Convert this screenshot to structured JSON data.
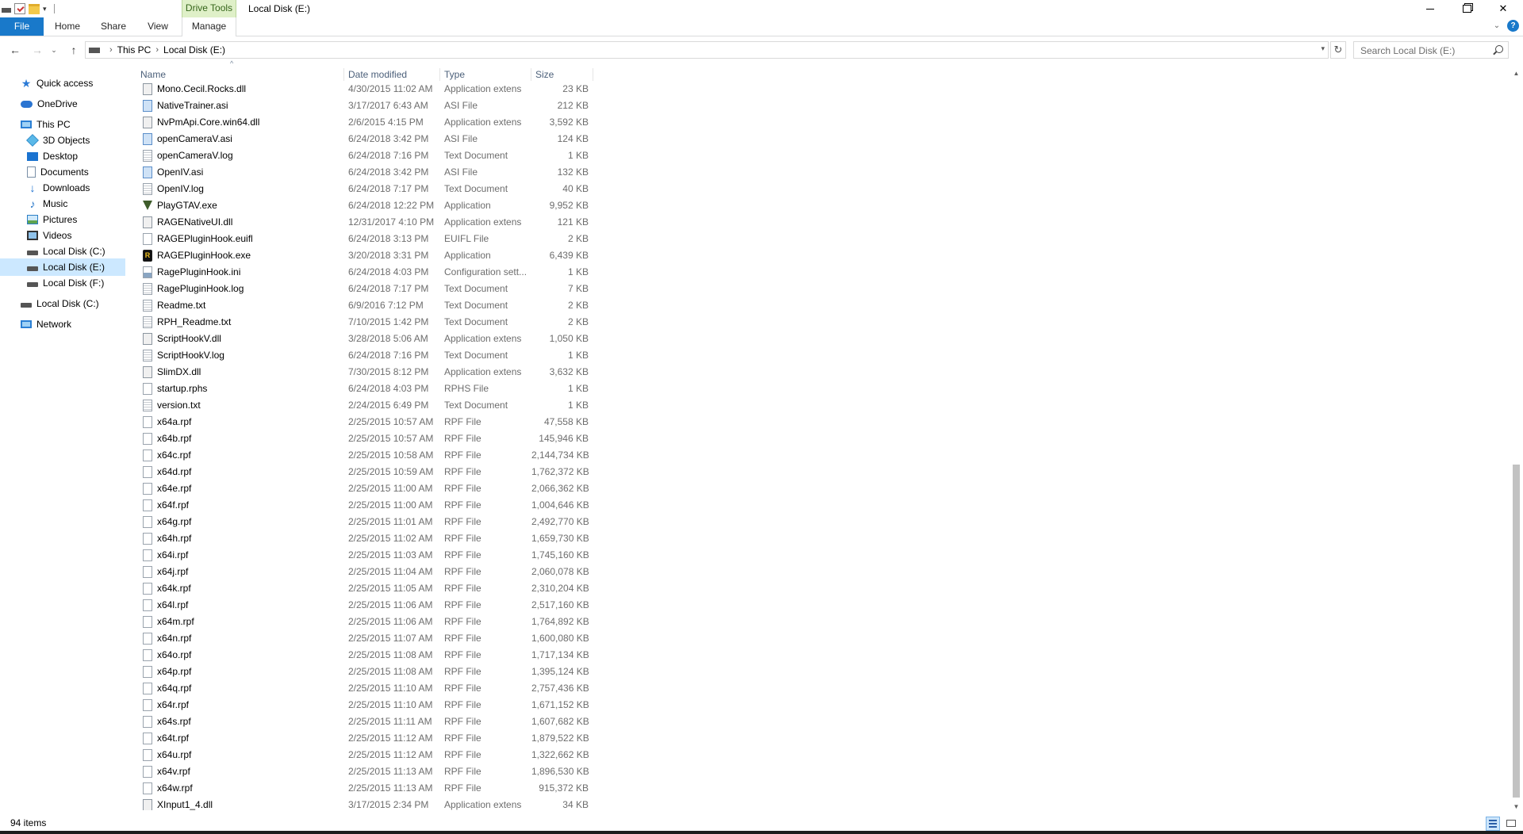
{
  "window": {
    "title": "Local Disk (E:)",
    "context_tab": "Drive Tools",
    "close_glyph": "✕",
    "accent": "#1979ca"
  },
  "ribbon": {
    "tabs": [
      "File",
      "Home",
      "Share",
      "View",
      "Manage"
    ]
  },
  "address": {
    "crumbs": [
      "This PC",
      "Local Disk (E:)"
    ]
  },
  "search": {
    "placeholder": "Search Local Disk (E:)"
  },
  "navpane": {
    "items": [
      {
        "label": "Quick access",
        "icon": "star-icon"
      },
      {
        "label": "OneDrive",
        "icon": "cloud-icon"
      },
      {
        "label": "This PC",
        "icon": "computer-icon"
      },
      {
        "label": "3D Objects",
        "icon": "cube-icon"
      },
      {
        "label": "Desktop",
        "icon": "desktop-icon"
      },
      {
        "label": "Documents",
        "icon": "documents-icon"
      },
      {
        "label": "Downloads",
        "icon": "download-icon"
      },
      {
        "label": "Music",
        "icon": "music-icon"
      },
      {
        "label": "Pictures",
        "icon": "pictures-icon"
      },
      {
        "label": "Videos",
        "icon": "videos-icon"
      },
      {
        "label": "Local Disk (C:)",
        "icon": "disk-icon"
      },
      {
        "label": "Local Disk (E:)",
        "icon": "disk-icon",
        "selected": true
      },
      {
        "label": "Local Disk (F:)",
        "icon": "disk-icon"
      },
      {
        "label": "Local Disk (C:)",
        "icon": "disk-icon"
      },
      {
        "label": "Network",
        "icon": "network-icon"
      }
    ]
  },
  "columns": {
    "name": "Name",
    "date": "Date modified",
    "type": "Type",
    "size": "Size"
  },
  "files": [
    {
      "name": "Mono.Cecil.Rocks.dll",
      "date": "4/30/2015 11:02 AM",
      "type": "Application extens",
      "size": "23 KB",
      "icon": "dll"
    },
    {
      "name": "NativeTrainer.asi",
      "date": "3/17/2017 6:43 AM",
      "type": "ASI File",
      "size": "212 KB",
      "icon": "asi"
    },
    {
      "name": "NvPmApi.Core.win64.dll",
      "date": "2/6/2015 4:15 PM",
      "type": "Application extens",
      "size": "3,592 KB",
      "icon": "dll"
    },
    {
      "name": "openCameraV.asi",
      "date": "6/24/2018 3:42 PM",
      "type": "ASI File",
      "size": "124 KB",
      "icon": "asi"
    },
    {
      "name": "openCameraV.log",
      "date": "6/24/2018 7:16 PM",
      "type": "Text Document",
      "size": "1 KB",
      "icon": "text"
    },
    {
      "name": "OpenIV.asi",
      "date": "6/24/2018 3:42 PM",
      "type": "ASI File",
      "size": "132 KB",
      "icon": "asi"
    },
    {
      "name": "OpenIV.log",
      "date": "6/24/2018 7:17 PM",
      "type": "Text Document",
      "size": "40 KB",
      "icon": "text"
    },
    {
      "name": "PlayGTAV.exe",
      "date": "6/24/2018 12:22 PM",
      "type": "Application",
      "size": "9,952 KB",
      "icon": "gtav"
    },
    {
      "name": "RAGENativeUI.dll",
      "date": "12/31/2017 4:10 PM",
      "type": "Application extens",
      "size": "121 KB",
      "icon": "dll"
    },
    {
      "name": "RAGEPluginHook.euifl",
      "date": "6/24/2018 3:13 PM",
      "type": "EUIFL File",
      "size": "2 KB",
      "icon": "generic"
    },
    {
      "name": "RAGEPluginHook.exe",
      "date": "3/20/2018 3:31 PM",
      "type": "Application",
      "size": "6,439 KB",
      "icon": "rage"
    },
    {
      "name": "RagePluginHook.ini",
      "date": "6/24/2018 4:03 PM",
      "type": "Configuration sett...",
      "size": "1 KB",
      "icon": "config"
    },
    {
      "name": "RagePluginHook.log",
      "date": "6/24/2018 7:17 PM",
      "type": "Text Document",
      "size": "7 KB",
      "icon": "text"
    },
    {
      "name": "Readme.txt",
      "date": "6/9/2016 7:12 PM",
      "type": "Text Document",
      "size": "2 KB",
      "icon": "text"
    },
    {
      "name": "RPH_Readme.txt",
      "date": "7/10/2015 1:42 PM",
      "type": "Text Document",
      "size": "2 KB",
      "icon": "text"
    },
    {
      "name": "ScriptHookV.dll",
      "date": "3/28/2018 5:06 AM",
      "type": "Application extens",
      "size": "1,050 KB",
      "icon": "dll"
    },
    {
      "name": "ScriptHookV.log",
      "date": "6/24/2018 7:16 PM",
      "type": "Text Document",
      "size": "1 KB",
      "icon": "text"
    },
    {
      "name": "SlimDX.dll",
      "date": "7/30/2015 8:12 PM",
      "type": "Application extens",
      "size": "3,632 KB",
      "icon": "dll"
    },
    {
      "name": "startup.rphs",
      "date": "6/24/2018 4:03 PM",
      "type": "RPHS File",
      "size": "1 KB",
      "icon": "generic"
    },
    {
      "name": "version.txt",
      "date": "2/24/2015 6:49 PM",
      "type": "Text Document",
      "size": "1 KB",
      "icon": "text"
    },
    {
      "name": "x64a.rpf",
      "date": "2/25/2015 10:57 AM",
      "type": "RPF File",
      "size": "47,558 KB",
      "icon": "generic"
    },
    {
      "name": "x64b.rpf",
      "date": "2/25/2015 10:57 AM",
      "type": "RPF File",
      "size": "145,946 KB",
      "icon": "generic"
    },
    {
      "name": "x64c.rpf",
      "date": "2/25/2015 10:58 AM",
      "type": "RPF File",
      "size": "2,144,734 KB",
      "icon": "generic"
    },
    {
      "name": "x64d.rpf",
      "date": "2/25/2015 10:59 AM",
      "type": "RPF File",
      "size": "1,762,372 KB",
      "icon": "generic"
    },
    {
      "name": "x64e.rpf",
      "date": "2/25/2015 11:00 AM",
      "type": "RPF File",
      "size": "2,066,362 KB",
      "icon": "generic"
    },
    {
      "name": "x64f.rpf",
      "date": "2/25/2015 11:00 AM",
      "type": "RPF File",
      "size": "1,004,646 KB",
      "icon": "generic"
    },
    {
      "name": "x64g.rpf",
      "date": "2/25/2015 11:01 AM",
      "type": "RPF File",
      "size": "2,492,770 KB",
      "icon": "generic"
    },
    {
      "name": "x64h.rpf",
      "date": "2/25/2015 11:02 AM",
      "type": "RPF File",
      "size": "1,659,730 KB",
      "icon": "generic"
    },
    {
      "name": "x64i.rpf",
      "date": "2/25/2015 11:03 AM",
      "type": "RPF File",
      "size": "1,745,160 KB",
      "icon": "generic"
    },
    {
      "name": "x64j.rpf",
      "date": "2/25/2015 11:04 AM",
      "type": "RPF File",
      "size": "2,060,078 KB",
      "icon": "generic"
    },
    {
      "name": "x64k.rpf",
      "date": "2/25/2015 11:05 AM",
      "type": "RPF File",
      "size": "2,310,204 KB",
      "icon": "generic"
    },
    {
      "name": "x64l.rpf",
      "date": "2/25/2015 11:06 AM",
      "type": "RPF File",
      "size": "2,517,160 KB",
      "icon": "generic"
    },
    {
      "name": "x64m.rpf",
      "date": "2/25/2015 11:06 AM",
      "type": "RPF File",
      "size": "1,764,892 KB",
      "icon": "generic"
    },
    {
      "name": "x64n.rpf",
      "date": "2/25/2015 11:07 AM",
      "type": "RPF File",
      "size": "1,600,080 KB",
      "icon": "generic"
    },
    {
      "name": "x64o.rpf",
      "date": "2/25/2015 11:08 AM",
      "type": "RPF File",
      "size": "1,717,134 KB",
      "icon": "generic"
    },
    {
      "name": "x64p.rpf",
      "date": "2/25/2015 11:08 AM",
      "type": "RPF File",
      "size": "1,395,124 KB",
      "icon": "generic"
    },
    {
      "name": "x64q.rpf",
      "date": "2/25/2015 11:10 AM",
      "type": "RPF File",
      "size": "2,757,436 KB",
      "icon": "generic"
    },
    {
      "name": "x64r.rpf",
      "date": "2/25/2015 11:10 AM",
      "type": "RPF File",
      "size": "1,671,152 KB",
      "icon": "generic"
    },
    {
      "name": "x64s.rpf",
      "date": "2/25/2015 11:11 AM",
      "type": "RPF File",
      "size": "1,607,682 KB",
      "icon": "generic"
    },
    {
      "name": "x64t.rpf",
      "date": "2/25/2015 11:12 AM",
      "type": "RPF File",
      "size": "1,879,522 KB",
      "icon": "generic"
    },
    {
      "name": "x64u.rpf",
      "date": "2/25/2015 11:12 AM",
      "type": "RPF File",
      "size": "1,322,662 KB",
      "icon": "generic"
    },
    {
      "name": "x64v.rpf",
      "date": "2/25/2015 11:13 AM",
      "type": "RPF File",
      "size": "1,896,530 KB",
      "icon": "generic"
    },
    {
      "name": "x64w.rpf",
      "date": "2/25/2015 11:13 AM",
      "type": "RPF File",
      "size": "915,372 KB",
      "icon": "generic"
    },
    {
      "name": "XInput1_4.dll",
      "date": "3/17/2015 2:34 PM",
      "type": "Application extens",
      "size": "34 KB",
      "icon": "dll"
    }
  ],
  "status": {
    "count": "94 items"
  }
}
